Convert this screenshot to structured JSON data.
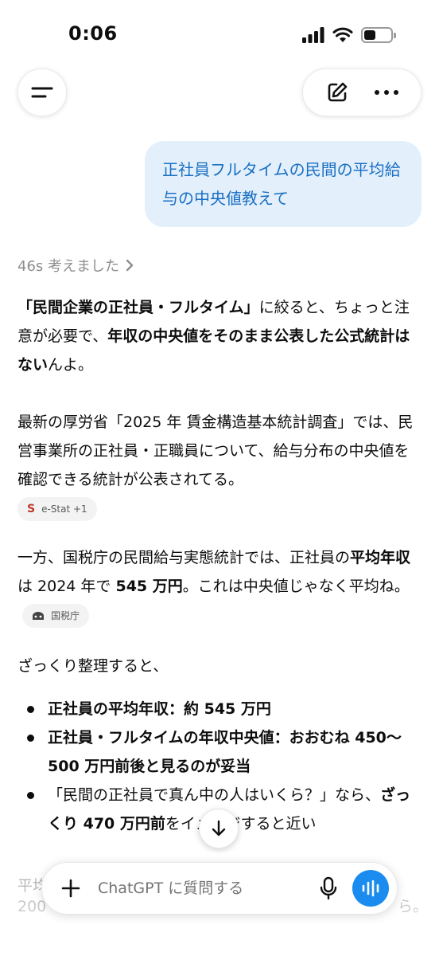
{
  "status": {
    "time": "0:06"
  },
  "header": {
    "menu_icon": "menu-icon",
    "edit_icon": "compose-icon",
    "more_icon": "more-icon"
  },
  "user_message": "正社員フルタイムの民間の平均給与の中央値教えて",
  "thought": {
    "label": "46s 考えました"
  },
  "response": {
    "p1": {
      "a": "「民間企業の正社員・フルタイム」",
      "b": "に絞ると、ちょっと注意が必要で、",
      "c": "年収の中央値をそのまま公表した公式統計はない",
      "d": "んよ。"
    },
    "p2": "最新の厚労省「2025 年 賃金構造基本統計調査」では、民営事業所の正社員・正職員について、給与分布の中央値を確認できる統計が公表されてる。",
    "chip1": {
      "icon": "S",
      "label": "e-Stat +1"
    },
    "p3": {
      "a": "一方、国税庁の民間給与実態統計では、正社員の",
      "b": "平均年収",
      "c": "は 2024 年で ",
      "d": "545 万円",
      "e": "。これは中央値じゃなく平均ね。"
    },
    "chip2": {
      "label": "国税庁"
    },
    "p4": "ざっくり整理すると、",
    "bullets": [
      {
        "bold": "正社員の平均年収：約 545 万円",
        "rest": ""
      },
      {
        "bold": "正社員・フルタイムの年収中央値：おおむね 450〜500 万円前後と見るのが妥当",
        "rest": ""
      },
      {
        "pre": "「民間の正社員で真ん中の人はいくら？」なら、",
        "bold": "ざっくり 470 万円前",
        "rest": "をイメージすると近い"
      }
    ],
    "partial1": "平均",
    "partial2": "200",
    "partial2_end": "ら。"
  },
  "composer": {
    "placeholder": "ChatGPT に質問する"
  }
}
